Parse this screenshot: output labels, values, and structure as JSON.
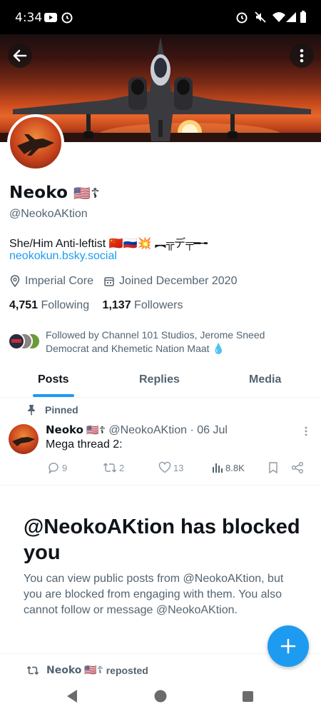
{
  "status_bar": {
    "time": "4:34"
  },
  "profile": {
    "name": "Neoko",
    "name_flair": "🇺🇸☦",
    "handle": "@NeokoAKtion",
    "bio": "She/Him  Anti-leftist 🇨🇳🇷🇺💥 ︻╦デ╤━╼",
    "link": "neokokun.bsky.social",
    "location": "Imperial Core",
    "joined": "Joined December 2020",
    "following_count": "4,751",
    "following_label": "Following",
    "followers_count": "1,137",
    "followers_label": "Followers",
    "followed_by": "Followed by Channel 101 Studios, Jerome Sneed Democrat and Khemetic Nation Maat 💧"
  },
  "tabs": [
    {
      "label": "Posts",
      "active": true
    },
    {
      "label": "Replies",
      "active": false
    },
    {
      "label": "Media",
      "active": false
    }
  ],
  "pinned_post": {
    "pinned_label": "Pinned",
    "author_name": "Neoko",
    "author_flair": "🇺🇸☦",
    "author_handle": "@NeokoAKtion",
    "date": "· 06 Jul",
    "text": "Mega thread 2:",
    "replies": "9",
    "reposts": "2",
    "likes": "13",
    "views": "8.8K"
  },
  "blocked": {
    "title": "@NeokoAKtion has blocked you",
    "description": "You can view public posts from @NeokoAKtion, but you are blocked from engaging with them. You also cannot follow or message @NeokoAKtion."
  },
  "repost_row": {
    "name": "Neoko",
    "flair": "🇺🇸☦",
    "label": "reposted"
  },
  "icons": {
    "back": "back-arrow-icon",
    "more": "more-vertical-icon",
    "location": "location-pin-icon",
    "calendar": "calendar-icon",
    "pin": "pin-icon",
    "reply": "reply-icon",
    "repost": "repost-icon",
    "like": "heart-icon",
    "views": "views-icon",
    "bookmark": "bookmark-icon",
    "share": "share-icon",
    "compose": "plus-icon"
  },
  "colors": {
    "accent": "#1d9bf0",
    "secondary_text": "#536471",
    "text": "#0f1419"
  }
}
